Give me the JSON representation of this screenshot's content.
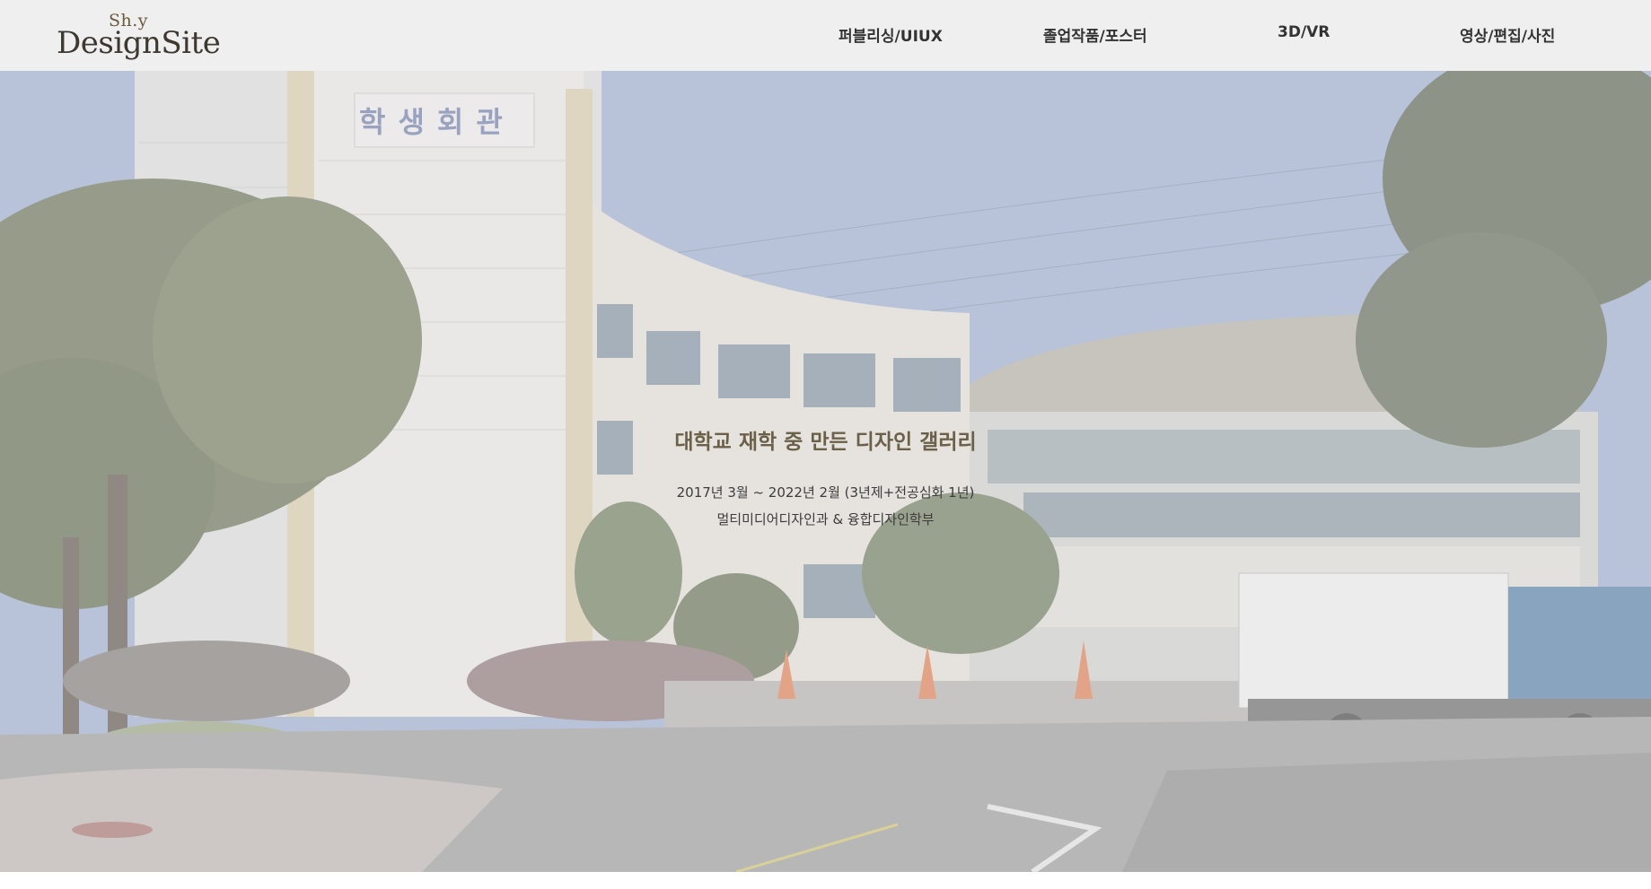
{
  "logo": {
    "small_text": "Sh.y",
    "main_text": "DesignSite"
  },
  "nav": {
    "items": [
      {
        "label": "퍼블리싱/UIUX"
      },
      {
        "label": "졸업작품/포스터"
      },
      {
        "label": "3D/VR"
      },
      {
        "label": "영상/편집/사진"
      }
    ]
  },
  "hero": {
    "title": "대학교 재학 중 만든 디자인 갤러리",
    "period": "2017년 3월 ~ 2022년 2월 (3년제+전공심화 1년)",
    "department": "멀티미디어디자인과 & 융합디자인학부",
    "building_sign": "학생회관"
  },
  "colors": {
    "header_bg": "#efefef",
    "title_color": "#6b6048",
    "text_color": "#3c3c3c"
  }
}
